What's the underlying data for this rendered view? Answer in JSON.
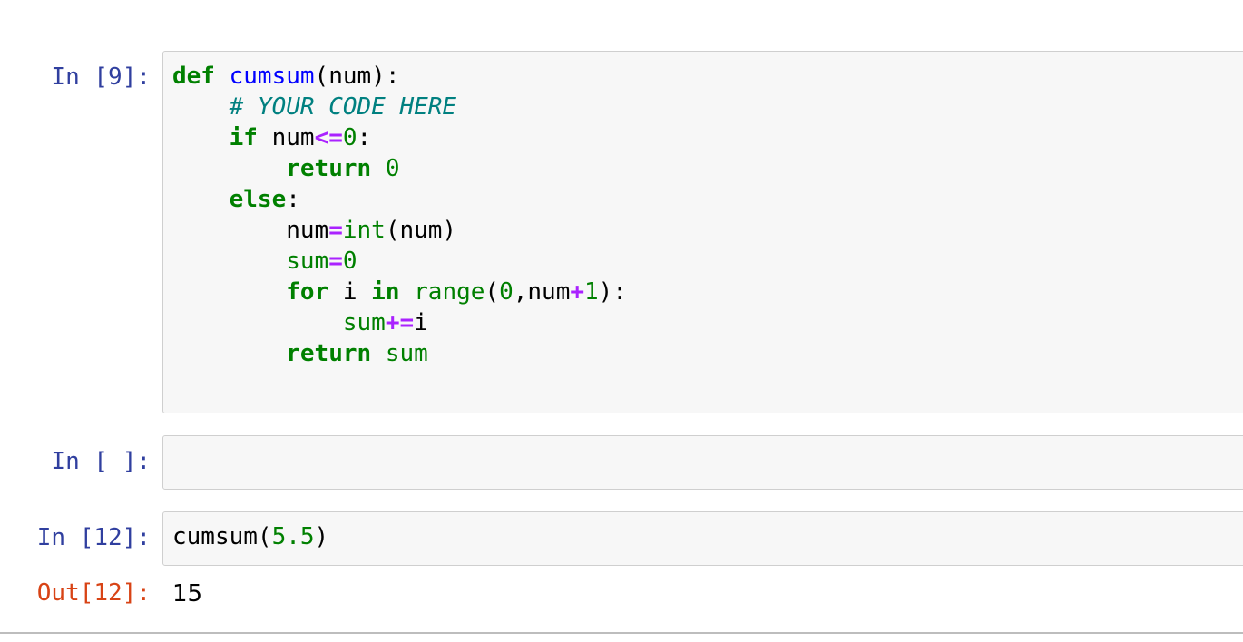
{
  "cells": [
    {
      "prompt": "In [9]:",
      "code_lines": [
        [
          {
            "t": "def",
            "c": "kw"
          },
          {
            "t": " ",
            "c": "plain"
          },
          {
            "t": "cumsum",
            "c": "fn"
          },
          {
            "t": "(num):",
            "c": "plain"
          }
        ],
        [
          {
            "t": "    ",
            "c": "plain"
          },
          {
            "t": "# YOUR CODE HERE",
            "c": "cm"
          }
        ],
        [
          {
            "t": "    ",
            "c": "plain"
          },
          {
            "t": "if",
            "c": "kw"
          },
          {
            "t": " num",
            "c": "plain"
          },
          {
            "t": "<=",
            "c": "op"
          },
          {
            "t": "0",
            "c": "nm"
          },
          {
            "t": ":",
            "c": "plain"
          }
        ],
        [
          {
            "t": "        ",
            "c": "plain"
          },
          {
            "t": "return",
            "c": "kw"
          },
          {
            "t": " ",
            "c": "plain"
          },
          {
            "t": "0",
            "c": "nm"
          }
        ],
        [
          {
            "t": "    ",
            "c": "plain"
          },
          {
            "t": "else",
            "c": "kw"
          },
          {
            "t": ":",
            "c": "plain"
          }
        ],
        [
          {
            "t": "        num",
            "c": "plain"
          },
          {
            "t": "=",
            "c": "op"
          },
          {
            "t": "int",
            "c": "bi"
          },
          {
            "t": "(num)",
            "c": "plain"
          }
        ],
        [
          {
            "t": "        ",
            "c": "plain"
          },
          {
            "t": "sum",
            "c": "vr"
          },
          {
            "t": "=",
            "c": "op"
          },
          {
            "t": "0",
            "c": "nm"
          }
        ],
        [
          {
            "t": "        ",
            "c": "plain"
          },
          {
            "t": "for",
            "c": "kw"
          },
          {
            "t": " i ",
            "c": "plain"
          },
          {
            "t": "in",
            "c": "kw"
          },
          {
            "t": " ",
            "c": "plain"
          },
          {
            "t": "range",
            "c": "bi"
          },
          {
            "t": "(",
            "c": "plain"
          },
          {
            "t": "0",
            "c": "nm"
          },
          {
            "t": ",num",
            "c": "plain"
          },
          {
            "t": "+",
            "c": "op"
          },
          {
            "t": "1",
            "c": "nm"
          },
          {
            "t": "):",
            "c": "plain"
          }
        ],
        [
          {
            "t": "            ",
            "c": "plain"
          },
          {
            "t": "sum",
            "c": "vr"
          },
          {
            "t": "+=",
            "c": "op"
          },
          {
            "t": "i",
            "c": "plain"
          }
        ],
        [
          {
            "t": "        ",
            "c": "plain"
          },
          {
            "t": "return",
            "c": "kw"
          },
          {
            "t": " ",
            "c": "plain"
          },
          {
            "t": "sum",
            "c": "vr"
          }
        ]
      ]
    },
    {
      "prompt": "In [ ]:",
      "code_lines": []
    },
    {
      "prompt": "In [12]:",
      "code_lines": [
        [
          {
            "t": "cumsum(",
            "c": "plain"
          },
          {
            "t": "5.5",
            "c": "nm"
          },
          {
            "t": ")",
            "c": "plain"
          }
        ]
      ],
      "output_prompt": "Out[12]:",
      "output_text": "15"
    }
  ],
  "colors": {
    "keyword": "#008000",
    "function_name": "#0000FF",
    "comment": "#008080",
    "operator": "#AA22FF",
    "number": "#008000",
    "in_prompt": "#303F9F",
    "out_prompt": "#D84315",
    "cell_background": "#f7f7f7"
  }
}
